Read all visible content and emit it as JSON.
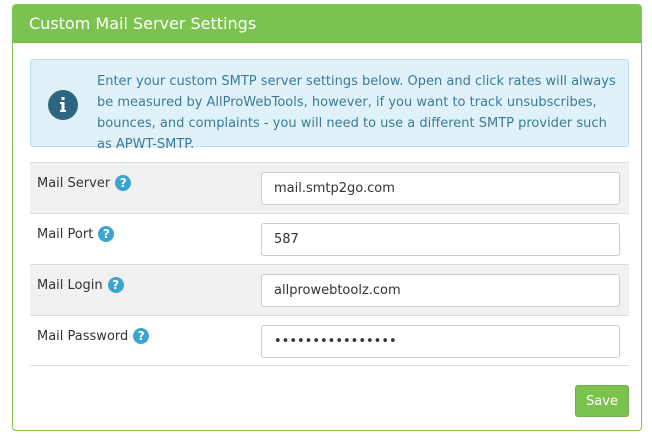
{
  "panel": {
    "title": "Custom Mail Server Settings"
  },
  "info": {
    "icon": "info-icon",
    "text": "Enter your custom SMTP server settings below. Open and click rates will always be measured by AllProWebTools, however, if you want to track unsubscribes, bounces, and complaints - you will need to use a different SMTP provider such as APWT-SMTP."
  },
  "fields": [
    {
      "label": "Mail Server",
      "value": "mail.smtp2go.com",
      "help_icon": "question-icon"
    },
    {
      "label": "Mail Port",
      "value": "587",
      "help_icon": "question-icon"
    },
    {
      "label": "Mail Login",
      "value": "allprowebtoolz.com",
      "help_icon": "question-icon"
    },
    {
      "label": "Mail Password",
      "value": "••••••••••••••••",
      "help_icon": "question-icon"
    }
  ],
  "actions": {
    "save_label": "Save"
  },
  "colors": {
    "accent": "#7cc24f",
    "info_bg": "#dff2f9",
    "info_text": "#3e7a96",
    "help_icon": "#3aa5cf"
  }
}
